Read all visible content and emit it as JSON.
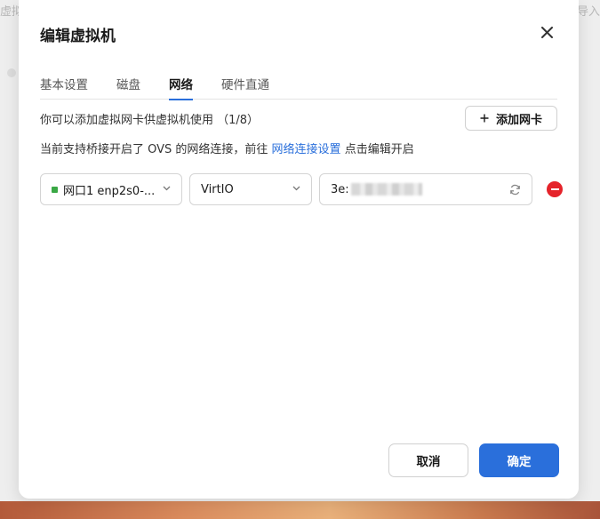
{
  "background": {
    "left_text": "虚拟",
    "right_text": "导入"
  },
  "dialog": {
    "title": "编辑虚拟机",
    "tabs": [
      {
        "label": "基本设置",
        "active": false
      },
      {
        "label": "磁盘",
        "active": false
      },
      {
        "label": "网络",
        "active": true
      },
      {
        "label": "硬件直通",
        "active": false
      }
    ],
    "info_text": "你可以添加虚拟网卡供虚拟机使用 （1/8）",
    "add_button_label": "添加网卡",
    "hint_prefix": "当前支持桥接开启了 OVS 的网络连接，前往 ",
    "hint_link": "网络连接设置",
    "hint_suffix": " 点击编辑开启",
    "nic": {
      "port_value": "网口1 enp2s0-...",
      "port_status_color": "#3aa845",
      "model_value": "VirtIO",
      "mac_prefix": "3e:"
    },
    "cancel_label": "取消",
    "ok_label": "确定"
  },
  "colors": {
    "accent": "#2a6fdb",
    "danger": "#e5232a"
  }
}
